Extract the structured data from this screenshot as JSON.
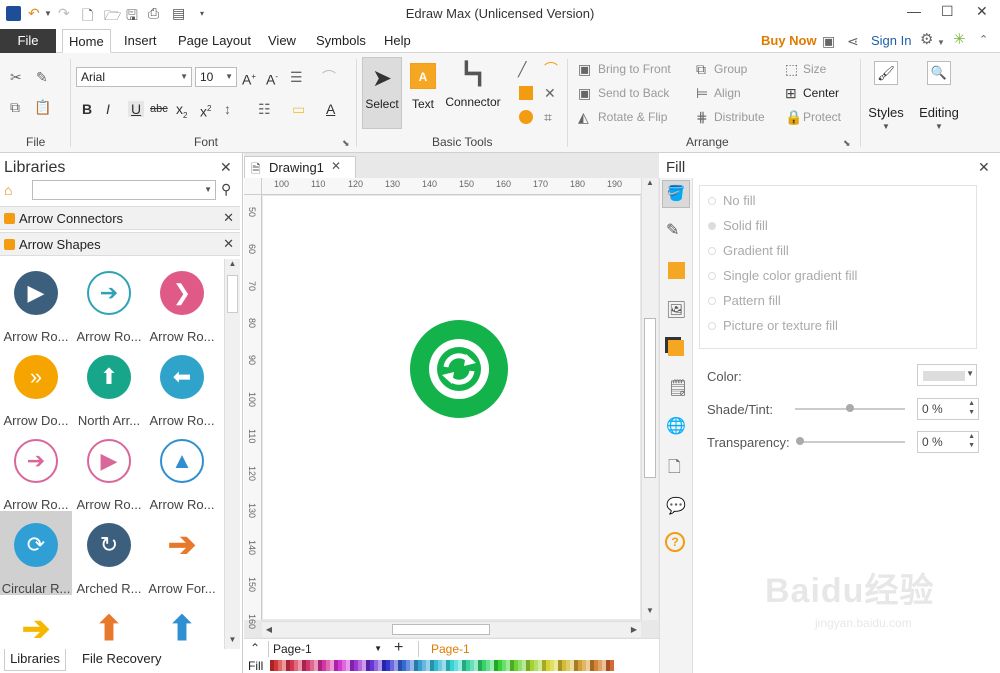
{
  "app": {
    "title": "Edraw Max (Unlicensed Version)"
  },
  "tabs": {
    "file": "File",
    "items": [
      "Home",
      "Insert",
      "Page Layout",
      "View",
      "Symbols",
      "Help"
    ],
    "active": "Home"
  },
  "top_right": {
    "buy_now": "Buy Now",
    "sign_in": "Sign In"
  },
  "ribbon": {
    "groups": {
      "file": "File",
      "font": "Font",
      "basic_tools": "Basic Tools",
      "arrange": "Arrange"
    },
    "font_name": "Arial",
    "font_size": "10",
    "basic": {
      "select": "Select",
      "text": "Text",
      "connector": "Connector"
    },
    "arrange": {
      "bring_to_front": "Bring to Front",
      "send_to_back": "Send to Back",
      "rotate_flip": "Rotate & Flip",
      "group": "Group",
      "align": "Align",
      "distribute": "Distribute",
      "size": "Size",
      "center": "Center",
      "protect": "Protect"
    },
    "styles": "Styles",
    "editing": "Editing"
  },
  "libraries": {
    "title": "Libraries",
    "categories": [
      "Arrow Connectors",
      "Arrow Shapes"
    ],
    "shapes": [
      {
        "label": "Arrow Ro...",
        "color": "#3d5f7e",
        "glyph": "▶",
        "style": "solid"
      },
      {
        "label": "Arrow Ro...",
        "color": "#2fa3b6",
        "glyph": "➔",
        "style": "ring"
      },
      {
        "label": "Arrow Ro...",
        "color": "#e05a87",
        "glyph": "❯",
        "style": "solid"
      },
      {
        "label": "Arrow Do...",
        "color": "#f5a400",
        "glyph": "»",
        "style": "solid"
      },
      {
        "label": "North Arr...",
        "color": "#17a68a",
        "glyph": "⬆",
        "style": "solid"
      },
      {
        "label": "Arrow Ro...",
        "color": "#2fa3c9",
        "glyph": "⬅",
        "style": "solid"
      },
      {
        "label": "Arrow Ro...",
        "color": "#d9679a",
        "glyph": "➔",
        "style": "ring"
      },
      {
        "label": "Arrow Ro...",
        "color": "#d9679a",
        "glyph": "▶",
        "style": "ring"
      },
      {
        "label": "Arrow Ro...",
        "color": "#2f8fd0",
        "glyph": "▲",
        "style": "ring"
      },
      {
        "label": "Circular R...",
        "color": "#2f9fd6",
        "glyph": "⟳",
        "style": "solid"
      },
      {
        "label": "Arched R...",
        "color": "#3d5f7e",
        "glyph": "↻",
        "style": "solid"
      },
      {
        "label": "Arrow For...",
        "color": "#e8792c",
        "glyph": "➔",
        "style": "plain"
      },
      {
        "label": "",
        "color": "#f5b800",
        "glyph": "➔",
        "style": "plain"
      },
      {
        "label": "",
        "color": "#e8792c",
        "glyph": "⬆",
        "style": "plain"
      },
      {
        "label": "",
        "color": "#2f8fd0",
        "glyph": "⬆",
        "style": "plain"
      }
    ],
    "bottom_tabs": [
      "Libraries",
      "File Recovery"
    ]
  },
  "document": {
    "tab": "Drawing1",
    "hruler_ticks": [
      "100",
      "110",
      "120",
      "130",
      "140",
      "150",
      "160",
      "170",
      "180",
      "190"
    ],
    "vruler_ticks": [
      "50",
      "60",
      "70",
      "80",
      "90",
      "100",
      "110",
      "120",
      "130",
      "140",
      "150",
      "160"
    ],
    "shape_color": "#13b24a",
    "page_selector": "Page-1",
    "page_tab": "Page-1",
    "palette_label": "Fill"
  },
  "fill_panel": {
    "title": "Fill",
    "options": [
      "No fill",
      "Solid fill",
      "Gradient fill",
      "Single color gradient fill",
      "Pattern fill",
      "Picture or texture fill"
    ],
    "color_label": "Color:",
    "shade_label": "Shade/Tint:",
    "shade_value": "0 %",
    "transparency_label": "Transparency:",
    "transparency_value": "0 %"
  },
  "watermark": {
    "text": "Baidu经验",
    "sub": "jingyan.baidu.com"
  }
}
